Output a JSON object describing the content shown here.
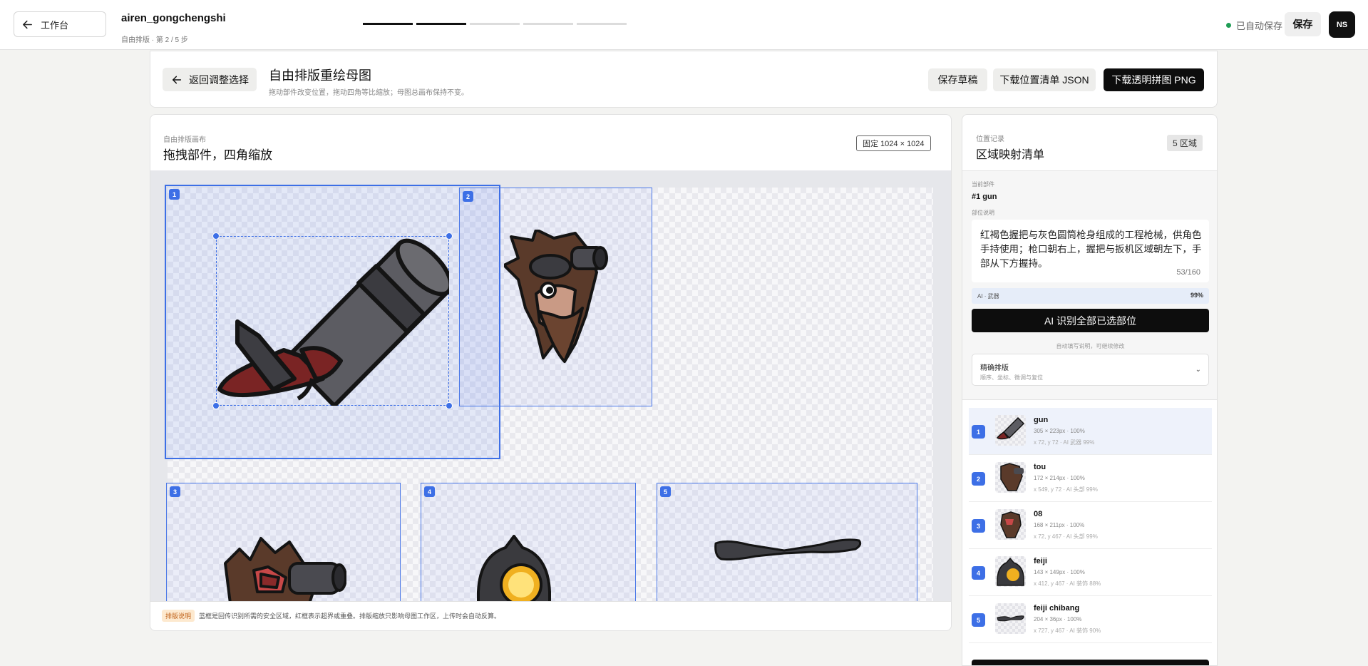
{
  "topbar": {
    "back_label": "工作台",
    "project_name": "airen_gongchengshi",
    "project_sub": "自由排版 · 第 2 / 5 步",
    "steps_total": 5,
    "steps_done": 2,
    "autosave": "已自动保存",
    "save": "保存",
    "avatar": "NS",
    "status_color": "#1f9d55"
  },
  "header": {
    "back_adjust": "返回调整选择",
    "title": "自由排版重绘母图",
    "subtitle": "拖动部件改变位置，拖动四角等比缩放；母图总画布保持不变。",
    "save_draft": "保存草稿",
    "download_json": "下载位置清单 JSON",
    "download_png": "下载透明拼图 PNG"
  },
  "canvas": {
    "label": "自由排版画布",
    "title": "拖拽部件，四角缩放",
    "size_badge": "固定 1024 × 1024",
    "footer_badge": "排版说明",
    "footer_text": "蓝框是回传识别所需的安全区域，红框表示超界或重叠。排版缩放只影响母图工作区，上传时会自动反算。",
    "parts": [
      "1",
      "2",
      "3",
      "4",
      "5"
    ],
    "accent": "#3d6fe6"
  },
  "panel": {
    "label": "位置记录",
    "title": "区域映射清单",
    "count": "5 区域",
    "current_label": "当前部件",
    "current_part": "#1 gun",
    "desc_label": "部位说明",
    "description": "红褐色握把与灰色圆筒枪身组成的工程枪械，供角色手持使用；枪口朝右上，握把与扳机区域朝左下，手部从下方握持。",
    "desc_count": "53/160",
    "ai_tag": "AI · 武器",
    "ai_conf": "99%",
    "ai_button": "AI 识别全部已选部位",
    "ai_hint": "自动填写说明，可继续修改",
    "precise_title": "精确排版",
    "precise_sub": "顺序、坐标、微调与复位",
    "chevron": "⌄",
    "items": [
      {
        "num": "1",
        "name": "gun",
        "size": "305 × 223px · 100%",
        "pos": "x 72, y 72 · AI 武器 99%"
      },
      {
        "num": "2",
        "name": "tou",
        "size": "172 × 214px · 100%",
        "pos": "x 549, y 72 · AI 头部 99%"
      },
      {
        "num": "3",
        "name": "08",
        "size": "168 × 211px · 100%",
        "pos": "x 72, y 467 · AI 头部 99%"
      },
      {
        "num": "4",
        "name": "feiji",
        "size": "143 × 149px · 100%",
        "pos": "x 412, y 467 · AI 装饰 88%"
      },
      {
        "num": "5",
        "name": "feiji chibang",
        "size": "204 × 36px · 100%",
        "pos": "x 727, y 467 · AI 装饰 90%"
      }
    ]
  }
}
